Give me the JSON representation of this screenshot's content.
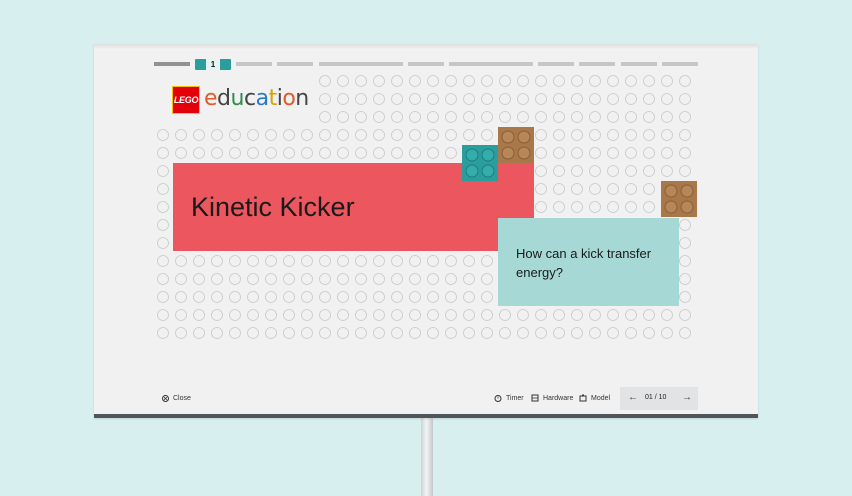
{
  "app": {
    "brand": "LEGO",
    "product": "education"
  },
  "progress": {
    "current_label": "1",
    "segment_count": 10,
    "current_index": 1
  },
  "lesson": {
    "title": "Kinetic Kicker",
    "question": "How can a kick transfer energy?"
  },
  "footer": {
    "close_label": "Close",
    "timer_label": "Timer",
    "hardware_label": "Hardware",
    "model_label": "Model",
    "page_indicator": "01 / 10"
  },
  "colors": {
    "background": "#d8eff0",
    "title_box": "#ec565f",
    "question_box": "#a6d9d5",
    "teal_brick": "#2a9d9d",
    "brown_brick": "#a8774a",
    "lego_red": "#e3000b"
  }
}
